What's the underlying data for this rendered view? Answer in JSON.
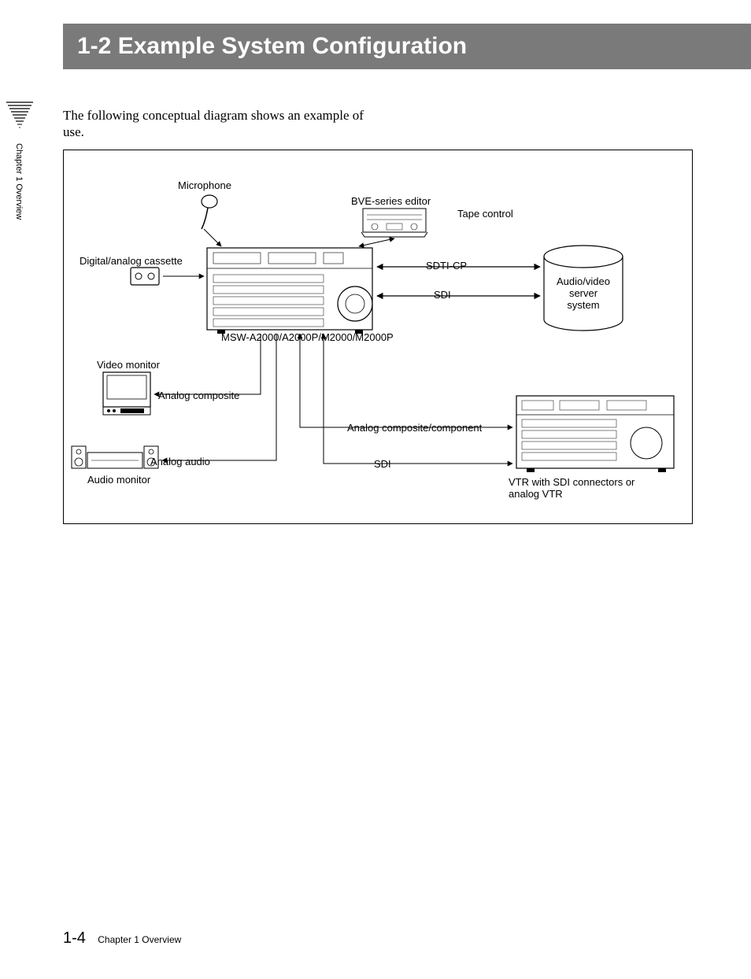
{
  "title": "1-2  Example System Configuration",
  "intro": "The following conceptual diagram shows an example of use.",
  "side_chapter": "Chapter 1   Overview",
  "diagram": {
    "microphone": "Microphone",
    "bve_editor": "BVE-series editor",
    "tape_control": "Tape control",
    "cassette": "Digital/analog cassette",
    "sdti_cp": "SDTI-CP",
    "sdi_top": "SDI",
    "server": "Audio/video server system",
    "main_unit": "MSW-A2000/A2000P/M2000/M2000P",
    "video_monitor": "Video monitor",
    "analog_composite": "Analog composite",
    "analog_comp_component": "Analog composite/component",
    "analog_audio": "Analog audio",
    "audio_monitor": "Audio monitor",
    "sdi_bottom": "SDI",
    "vtr": "VTR with SDI connectors or analog VTR"
  },
  "footer": {
    "page": "1-4",
    "chapter": "Chapter 1   Overview"
  }
}
